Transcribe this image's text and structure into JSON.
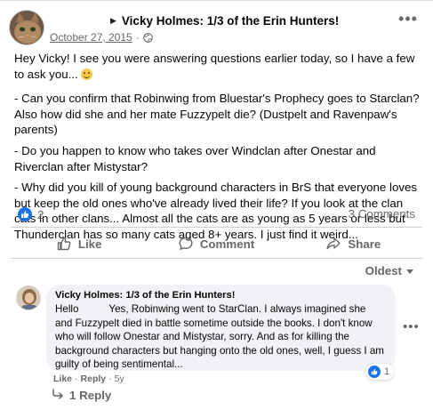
{
  "post": {
    "author_title": "Vicky Holmes: 1/3 of the Erin Hunters!",
    "date": "October 27, 2015",
    "separator": "·",
    "paragraphs": [
      "Hey Vicky! I see you were answering questions earlier today, so I have a few to ask you...",
      "- Can you confirm that Robinwing from Bluestar's Prophecy goes to Starclan? Also how did she and her mate Fuzzypelt die? (Dustpelt and Ravenpaw's parents)",
      "- Do you happen to know who takes over Windclan after Onestar and Riverclan after Mistystar?",
      "- Why did you kill of young background characters in BrS that everyone loves but keep the old ones who've already lived their life? If you look at the clan cats in other clans... Almost all the cats are as young as 5 years or less but Thunderclan has so many cats aged 8+ years. I just find it weird..."
    ],
    "reaction_count": "2",
    "comments_count": "3 Comments"
  },
  "actions": {
    "like": "Like",
    "comment": "Comment",
    "share": "Share"
  },
  "sort": {
    "label": "Oldest"
  },
  "comment": {
    "author": "Vicky Holmes: 1/3 of the Erin Hunters!",
    "greeting": "Hello",
    "text": "Yes, Robinwing went to StarClan. I always imagined she and Fuzzypelt died in battle sometime outside the books. I don't know who will follow Onestar and Mistystar, sorry. And as for killing the background characters but hanging onto the old ones, well, I guess I am guilty of being sentimental...",
    "like_label": "Like",
    "reply_label": "Reply",
    "dot": "·",
    "age": "5y",
    "reaction_count": "1",
    "replies_label": "1 Reply"
  },
  "colors": {
    "accent": "#1b74e4",
    "secondary_text": "#65676b",
    "bubble": "#f0f2f5"
  },
  "icons": {
    "header_caret": "caret-right-icon",
    "privacy": "globe-icon",
    "more": "more-horizontal-icon",
    "like": "thumbs-up-icon",
    "comment": "speech-bubble-icon",
    "share": "share-arrow-icon",
    "sort": "chevron-down-icon",
    "reply": "reply-arrow-icon"
  }
}
